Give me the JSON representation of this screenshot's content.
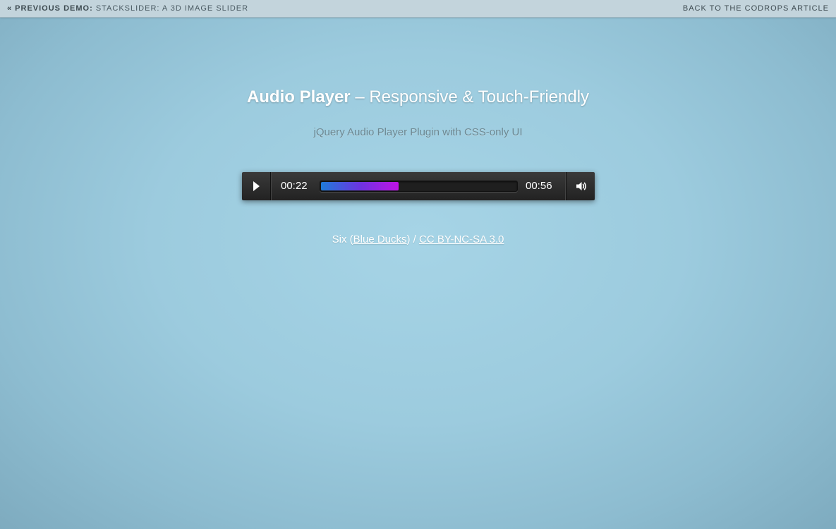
{
  "topbar": {
    "prev_label": "« Previous Demo:",
    "prev_title": "StackSlider: A 3D Image Slider",
    "back_link": "Back to the Codrops Article"
  },
  "header": {
    "title_main": "Audio Player",
    "title_dash": " – ",
    "title_sub": "Responsive & Touch-Friendly",
    "subtitle": "jQuery Audio Player Plugin with CSS-only UI"
  },
  "player": {
    "current_time": "00:22",
    "duration": "00:56",
    "progress_fraction": 0.393,
    "play_icon": "play-icon",
    "volume_icon": "volume-icon",
    "colors": {
      "progress_start": "#1f7bd8",
      "progress_end": "#c013e6"
    }
  },
  "credits": {
    "track": "Six (",
    "artist": "Blue Ducks",
    "separator": ") / ",
    "license": "CC BY-NC-SA 3.0"
  }
}
